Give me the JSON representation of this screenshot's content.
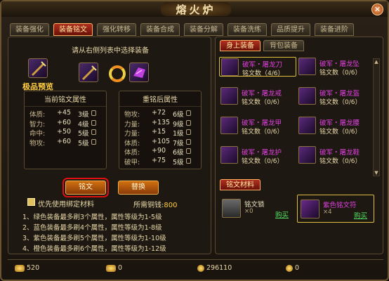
{
  "window": {
    "title": "熔火炉",
    "close": "✕"
  },
  "tabs": [
    "装备强化",
    "装备铭文",
    "强化转移",
    "装备合成",
    "装备分解",
    "装备洗练",
    "品质提升",
    "装备进阶"
  ],
  "hint": "请从右侧列表中选择装备",
  "quality": "极品预览",
  "current": {
    "title": "当前铭文属性",
    "rows": [
      [
        "体质:",
        "+45",
        "3级"
      ],
      [
        "智力:",
        "+60",
        "4级"
      ],
      [
        "命中:",
        "+50",
        "5级"
      ],
      [
        "物攻:",
        "+60",
        "5级"
      ]
    ]
  },
  "after": {
    "title": "重铭后属性",
    "rows": [
      [
        "物攻:",
        "+72",
        "6级"
      ],
      [
        "力量:",
        "+135",
        "9级"
      ],
      [
        "力量:",
        "+15",
        "1级"
      ],
      [
        "体质:",
        "+105",
        "7级"
      ],
      [
        "体质:",
        "+90",
        "6级"
      ],
      [
        "破甲:",
        "+75",
        "5级"
      ]
    ]
  },
  "buttons": {
    "inscribe": "铭文",
    "replace": "替换"
  },
  "bind_label": "优先使用绑定材料",
  "cost": {
    "label": "所需铜钱:",
    "value": "800"
  },
  "rules": [
    "1、绿色装备最多刷3个属性，属性等级为1-5级",
    "2、蓝色装备最多刷4个属性，属性等级为1-8级",
    "3、紫色装备最多刷5个属性，属性等级为1-10级",
    "4、橙色装备最多刷6个属性，属性等级为1-12级"
  ],
  "right_tabs": [
    "身上装备",
    "背包装备"
  ],
  "equips": [
    {
      "name": "破军・屠龙刀",
      "count": "铭文数（4/6）"
    },
    {
      "name": "破军・屠龙坠",
      "count": "铭文数（0/6）"
    },
    {
      "name": "破军・屠龙戒",
      "count": "铭文数（0/6）"
    },
    {
      "name": "破军・屠龙盔",
      "count": "铭文数（0/6）"
    },
    {
      "name": "破军・屠龙甲",
      "count": "铭文数（0/6）"
    },
    {
      "name": "破军・屠龙腰",
      "count": "铭文数（0/6）"
    },
    {
      "name": "破军・屠龙护",
      "count": "铭文数（0/6）"
    },
    {
      "name": "破军・屠龙鞋",
      "count": "铭文数（0/6）"
    }
  ],
  "materials_tab": "铭文材料",
  "materials": [
    {
      "name": "铭文锁",
      "count": "×0",
      "buy": "购买",
      "color": "#e8e0c0"
    },
    {
      "name": "紫色铭文符",
      "count": "×4",
      "buy": "购买",
      "color": "#e040e0"
    }
  ],
  "currency": [
    "520",
    "0",
    "296110",
    "0"
  ],
  "colors": {
    "accent": "#b03020",
    "gold": "#ffd040",
    "purple": "#e040e0"
  }
}
